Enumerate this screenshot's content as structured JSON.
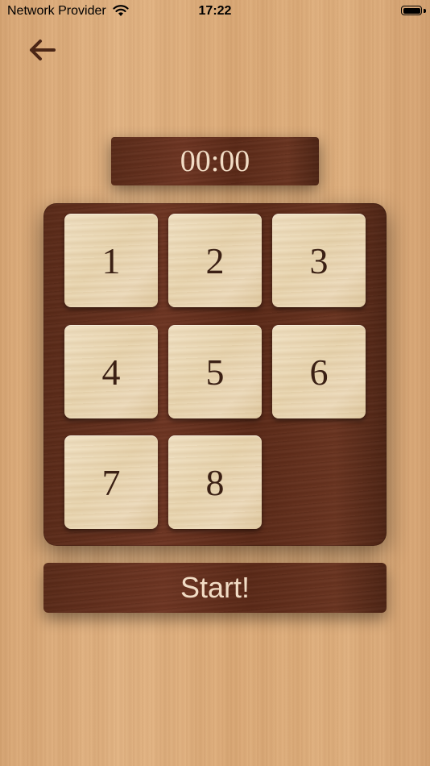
{
  "status_bar": {
    "carrier": "Network Provider",
    "time": "17:22",
    "wifi_icon": "wifi-icon",
    "battery_icon": "battery-icon"
  },
  "nav": {
    "back_icon": "arrow-left-icon"
  },
  "timer": {
    "value": "00:00"
  },
  "puzzle": {
    "grid": "3x3",
    "empty_cell": 9,
    "tiles": [
      "1",
      "2",
      "3",
      "4",
      "5",
      "6",
      "7",
      "8"
    ]
  },
  "start_button": {
    "label": "Start!"
  },
  "colors": {
    "background_wood": "#e0b180",
    "dark_wood": "#5f2c1a",
    "tile_wood": "#ecdabb",
    "number_text": "#3b2014",
    "light_text": "#f1dcc5"
  }
}
